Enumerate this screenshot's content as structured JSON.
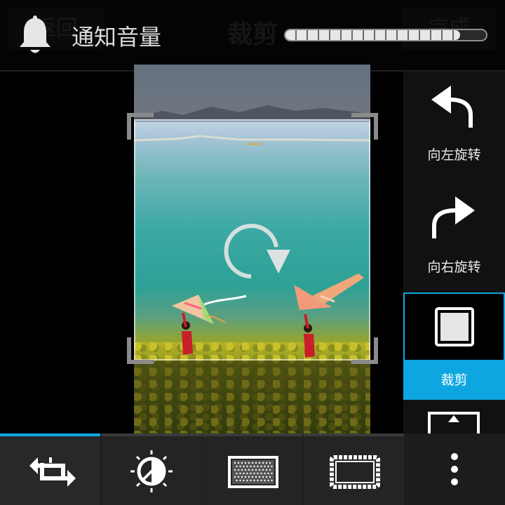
{
  "action_bar": {
    "back_label": "返回",
    "title": "裁剪",
    "done_label": "完成"
  },
  "volume": {
    "label": "通知音量",
    "level_fraction": 0.87,
    "icon": "bell-icon"
  },
  "side_panel": {
    "items": [
      {
        "label": "向左旋转",
        "icon": "rotate-left-arrow-icon"
      },
      {
        "label": "向右旋转",
        "icon": "rotate-right-arrow-icon"
      },
      {
        "label": "裁剪",
        "icon": "crop-square-icon",
        "selected": true
      },
      {
        "label": "",
        "icon": "straighten-icon"
      }
    ]
  },
  "bottom_toolbar": {
    "buttons": [
      {
        "icon": "transform-arrows-icon",
        "active": true
      },
      {
        "icon": "brightness-contrast-icon",
        "active": false
      },
      {
        "icon": "texture-filter-icon",
        "active": false
      },
      {
        "icon": "film-frame-icon",
        "active": false
      },
      {
        "icon": "overflow-menu-icon",
        "active": false
      }
    ]
  },
  "colors": {
    "accent": "#0ea6e0",
    "panel_bg": "#111111",
    "toolbar_bg": "#242424"
  }
}
